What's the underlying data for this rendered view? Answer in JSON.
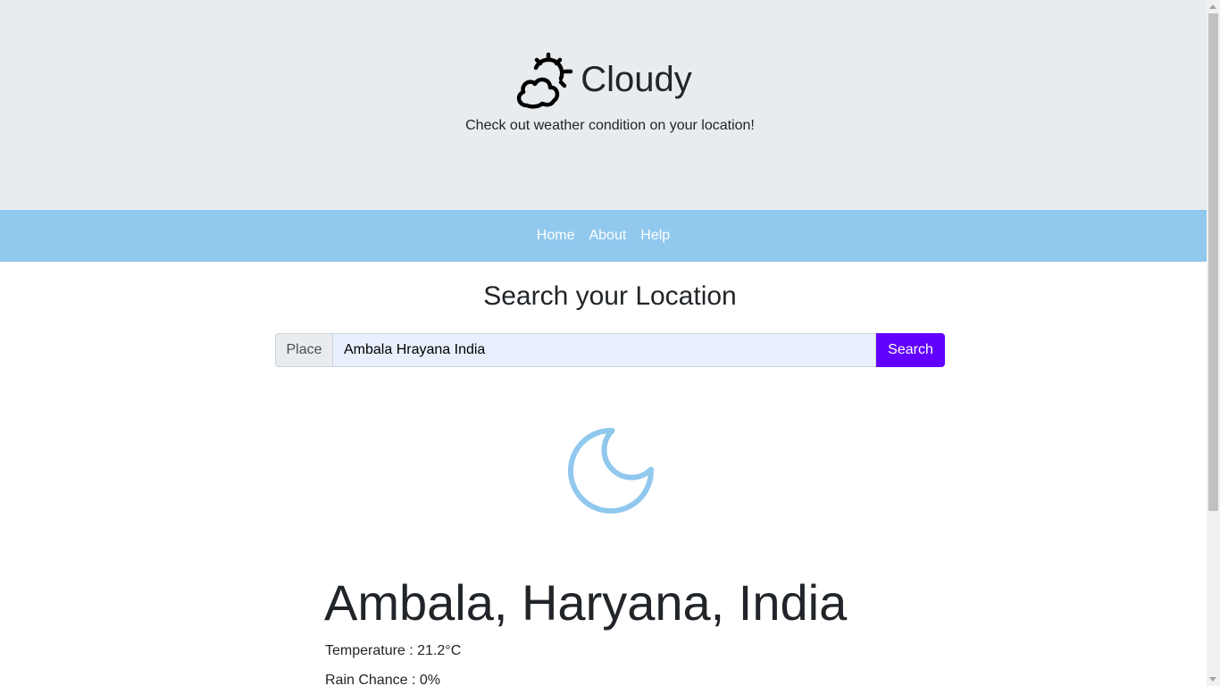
{
  "header": {
    "brand_icon": "cloud-sun-icon",
    "title": "Cloudy",
    "tagline": "Check out weather condition on your location!"
  },
  "nav": {
    "items": [
      {
        "label": "Home"
      },
      {
        "label": "About"
      },
      {
        "label": "Help"
      }
    ]
  },
  "search": {
    "heading": "Search your Location",
    "prefix_label": "Place",
    "value": "Ambala Hrayana India",
    "button_label": "Search"
  },
  "result": {
    "condition_icon": "moon-icon",
    "location": "Ambala, Haryana, India",
    "temperature": "Temperature : 21.2°C",
    "rain_chance": "Rain Chance : 0%"
  },
  "colors": {
    "hero_bg": "#e9ecef",
    "nav_bg": "#90c8ee",
    "search_button": "#6200ff",
    "icon_accent": "#90c8ee"
  }
}
